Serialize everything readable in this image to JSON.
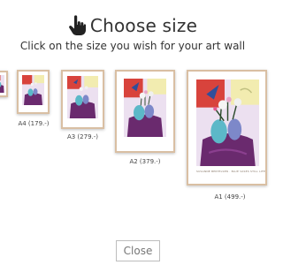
{
  "dialog": {
    "title": "Choose size",
    "subtitle": "Click on the size you wish for your art wall",
    "title_icon": "hand-pointer-icon",
    "close_label": "Close"
  },
  "sizes": [
    {
      "id": "a5",
      "caption": "..-)"
    },
    {
      "id": "a4",
      "caption": "A4 (179.-)"
    },
    {
      "id": "a3",
      "caption": "A3 (279.-)"
    },
    {
      "id": "a2",
      "caption": "A2 (379.-)"
    },
    {
      "id": "a1",
      "caption": "A1 (499.-)",
      "artist_text": "SUSANNE BERTELSEN · BLUE VASES STILL LIFE"
    }
  ],
  "colors": {
    "frame": "#d9bfa3",
    "artwork_red": "#d8433c",
    "artwork_purple": "#6a2a6e",
    "artwork_blue": "#5cb8c8"
  }
}
